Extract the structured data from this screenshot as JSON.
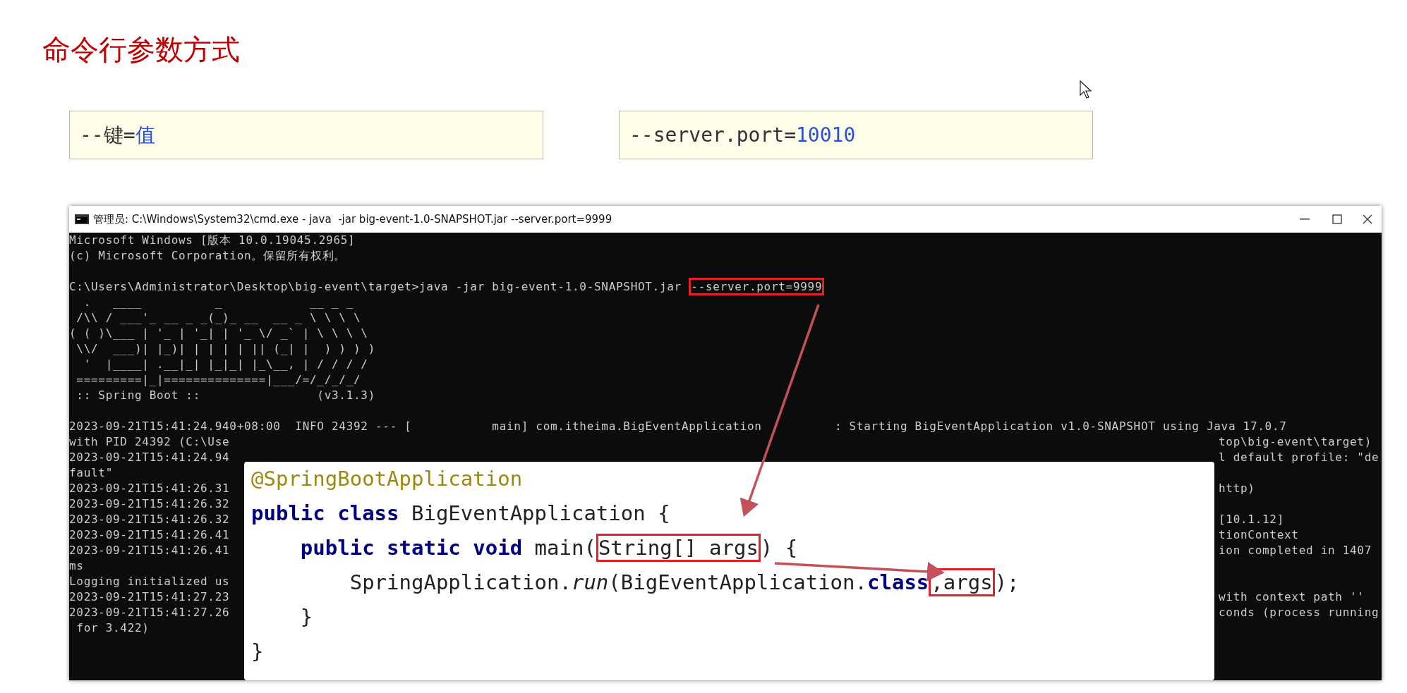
{
  "slide_title": "命令行参数方式",
  "examples": [
    {
      "parts": [
        {
          "kind": "plain",
          "text": "--键="
        },
        {
          "kind": "value",
          "text": "值"
        }
      ]
    },
    {
      "parts": [
        {
          "kind": "plain",
          "text": "--server.port="
        },
        {
          "kind": "value",
          "text": "10010"
        }
      ]
    }
  ],
  "terminal": {
    "title": "管理员: C:\\Windows\\System32\\cmd.exe - java  -jar big-event-1.0-SNAPSHOT.jar --server.port=9999",
    "lines": [
      {
        "kind": "text",
        "text": "Microsoft Windows [版本 10.0.19045.2965]"
      },
      {
        "kind": "text",
        "text": "(c) Microsoft Corporation。保留所有权利。"
      },
      {
        "kind": "blank"
      },
      {
        "kind": "text",
        "text": "C:\\Users\\Administrator\\Desktop\\big-event\\target>java -jar big-event-1.0-SNAPSHOT.jar ",
        "boxed": "--server.port=9999"
      },
      {
        "kind": "text",
        "text": "  .   ____          _            __ _ _"
      },
      {
        "kind": "text",
        "text": " /\\\\ / ___'_ __ _ _(_)_ __  __ _ \\ \\ \\ \\"
      },
      {
        "kind": "text",
        "text": "( ( )\\___ | '_ | '_| | '_ \\/ _` | \\ \\ \\ \\"
      },
      {
        "kind": "text",
        "text": " \\\\/  ___)| |_)| | | | | || (_| |  ) ) ) )"
      },
      {
        "kind": "text",
        "text": "  '  |____| .__|_| |_|_| |_\\__, | / / / /"
      },
      {
        "kind": "text",
        "text": " =========|_|==============|___/=/_/_/_/"
      },
      {
        "kind": "text",
        "text": " :: Spring Boot ::                (v3.1.3)"
      },
      {
        "kind": "blank"
      },
      {
        "kind": "text",
        "text": "2023-09-21T15:41:24.940+08:00  INFO 24392 --- [           main] com.itheima.BigEventApplication          : Starting BigEventApplication v1.0-SNAPSHOT using Java 17.0.7"
      },
      {
        "kind": "text",
        "text": "with PID 24392 (C:\\Use",
        "right": "top\\big-event\\target)"
      },
      {
        "kind": "text",
        "text": "2023-09-21T15:41:24.94",
        "right": "l default profile: \"de"
      },
      {
        "kind": "text",
        "text": "fault\""
      },
      {
        "kind": "text",
        "text": "2023-09-21T15:41:26.31",
        "right": "http)"
      },
      {
        "kind": "text",
        "text": "2023-09-21T15:41:26.32"
      },
      {
        "kind": "text",
        "text": "2023-09-21T15:41:26.32",
        "right": "[10.1.12]"
      },
      {
        "kind": "text",
        "text": "2023-09-21T15:41:26.41",
        "right": "tionContext"
      },
      {
        "kind": "text",
        "text": "2023-09-21T15:41:26.41",
        "right": "ion completed in 1407"
      },
      {
        "kind": "text",
        "text": "ms"
      },
      {
        "kind": "text",
        "text": "Logging initialized us"
      },
      {
        "kind": "text",
        "text": "2023-09-21T15:41:27.23",
        "right": "with context path ''"
      },
      {
        "kind": "text",
        "text": "2023-09-21T15:41:27.26",
        "right": "conds (process running"
      },
      {
        "kind": "text",
        "text": " for 3.422)"
      }
    ]
  },
  "code": {
    "lines": [
      [
        {
          "kind": "annotation",
          "text": "@SpringBootApplication"
        }
      ],
      [
        {
          "kind": "keyword",
          "text": "public class"
        },
        {
          "kind": "plain",
          "text": " BigEventApplication {"
        }
      ],
      [
        {
          "kind": "keyword",
          "text": "    public static void"
        },
        {
          "kind": "plain",
          "text": " main("
        },
        {
          "kind": "boxed",
          "text": "String[] args"
        },
        {
          "kind": "plain",
          "text": ") {"
        }
      ],
      [
        {
          "kind": "plain",
          "text": "        SpringApplication."
        },
        {
          "kind": "italic",
          "text": "run"
        },
        {
          "kind": "plain",
          "text": "(BigEventApplication."
        },
        {
          "kind": "keyword",
          "text": "class"
        },
        {
          "kind": "boxed",
          "text": ",args"
        },
        {
          "kind": "plain",
          "text": ");"
        }
      ],
      [
        {
          "kind": "plain",
          "text": "    }"
        }
      ],
      [
        {
          "kind": "plain",
          "text": "}"
        }
      ]
    ]
  }
}
